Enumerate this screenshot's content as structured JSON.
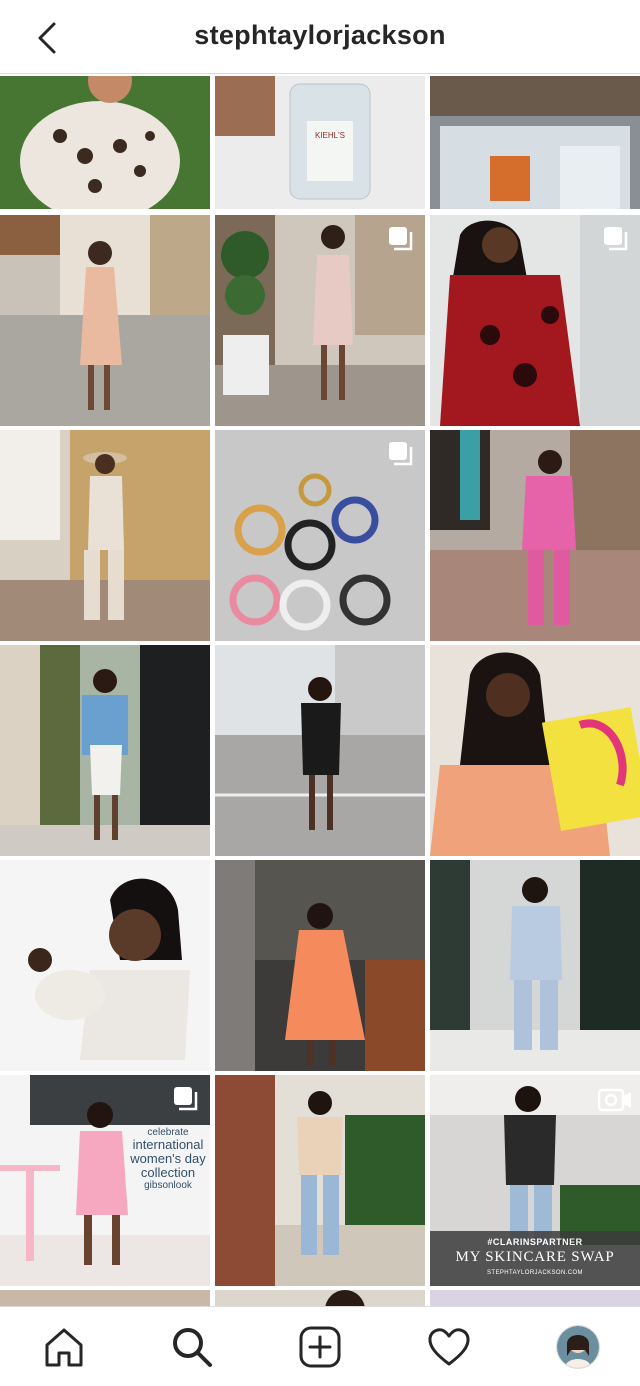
{
  "header": {
    "username": "stephtaylorjackson"
  },
  "posts": {
    "women_day": {
      "line1": "celebrate",
      "line2": "international",
      "line3": "women's day",
      "line4": "collection",
      "line5": "gibsonlook"
    },
    "clarins": {
      "hashtag": "#CLARINSPARTNER",
      "caption": "MY SKINCARE SWAP",
      "site": "STEPHTAYLORJACKSON.COM"
    }
  },
  "icons": {
    "back": "chevron-left-icon",
    "multi": "multiple-photos-icon",
    "video": "camera-icon",
    "home": "home-icon",
    "search": "search-icon",
    "add": "plus-square-icon",
    "activity": "heart-icon"
  },
  "colors": {
    "border": "#dbdbdb",
    "text": "#262626"
  }
}
